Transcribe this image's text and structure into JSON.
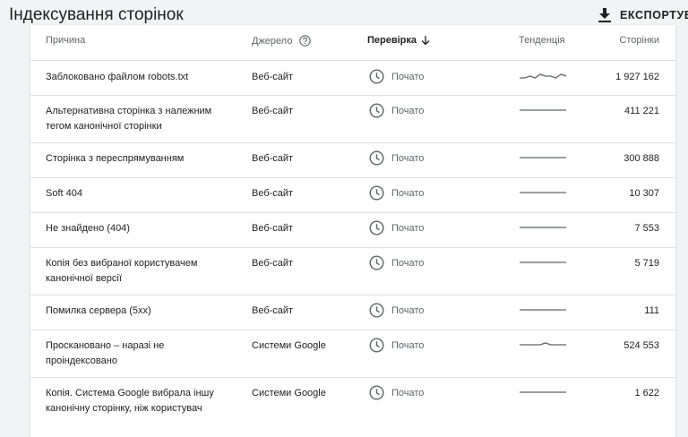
{
  "header": {
    "title": "Індексування сторінок",
    "export_label": "ЕКСПОРТУВА"
  },
  "table": {
    "columns": {
      "reason": "Причина",
      "source": "Джерело",
      "check": "Перевірка",
      "trend": "Тенденція",
      "pages": "Сторінки"
    },
    "rows": [
      {
        "reason": "Заблоковано файлом robots.txt",
        "source": "Веб-сайт",
        "status": "Почато",
        "pages": "1 927 162",
        "trend": [
          3,
          3,
          2,
          3,
          1,
          2,
          2,
          3,
          1,
          2
        ]
      },
      {
        "reason": "Альтернативна сторінка з належним тегом канонічної сторінки",
        "source": "Веб-сайт",
        "status": "Почато",
        "pages": "411 221",
        "trend": [
          2,
          2,
          2,
          2,
          2,
          2,
          2,
          2,
          2,
          2
        ]
      },
      {
        "reason": "Сторінка з переспрямуванням",
        "source": "Веб-сайт",
        "status": "Почато",
        "pages": "300 888",
        "trend": [
          2,
          2,
          2,
          2,
          2,
          2,
          2,
          2,
          2,
          2
        ]
      },
      {
        "reason": "Soft 404",
        "source": "Веб-сайт",
        "status": "Почато",
        "pages": "10 307",
        "trend": [
          2,
          2,
          2,
          2,
          2,
          2,
          2,
          2,
          2,
          2
        ]
      },
      {
        "reason": "Не знайдено (404)",
        "source": "Веб-сайт",
        "status": "Почато",
        "pages": "7 553",
        "trend": [
          2,
          2,
          2,
          2,
          2,
          2,
          2,
          2,
          2,
          2
        ]
      },
      {
        "reason": "Копія без вибраної користувачем канонічної версії",
        "source": "Веб-сайт",
        "status": "Почато",
        "pages": "5 719",
        "trend": [
          2,
          2,
          2,
          2,
          2,
          2,
          2,
          2,
          2,
          2
        ]
      },
      {
        "reason": "Помилка сервера (5xx)",
        "source": "Веб-сайт",
        "status": "Почато",
        "pages": "111",
        "trend": [
          2,
          2,
          2,
          2,
          2,
          2,
          2,
          2,
          2,
          2
        ]
      },
      {
        "reason": "Проскановано – наразі не проіндексовано",
        "source": "Системи Google",
        "status": "Почато",
        "pages": "524 553",
        "trend": [
          2,
          2,
          2,
          2,
          2,
          1,
          2,
          2,
          2,
          2
        ]
      },
      {
        "reason": "Копія. Система Google вибрала іншу канонічну сторінку, ніж користувач",
        "source": "Системи Google",
        "status": "Почато",
        "pages": "1 622",
        "trend": [
          2,
          2,
          2,
          2,
          2,
          2,
          2,
          2,
          2,
          2
        ]
      }
    ]
  },
  "colors": {
    "accent": "#202124",
    "muted": "#5f6368",
    "sparkline": "#5f6368",
    "divider": "#e0e0e0"
  },
  "icons": {
    "export": "download-icon",
    "help": "help-circle-icon",
    "sort": "arrow-down-icon",
    "status": "clock-icon"
  }
}
